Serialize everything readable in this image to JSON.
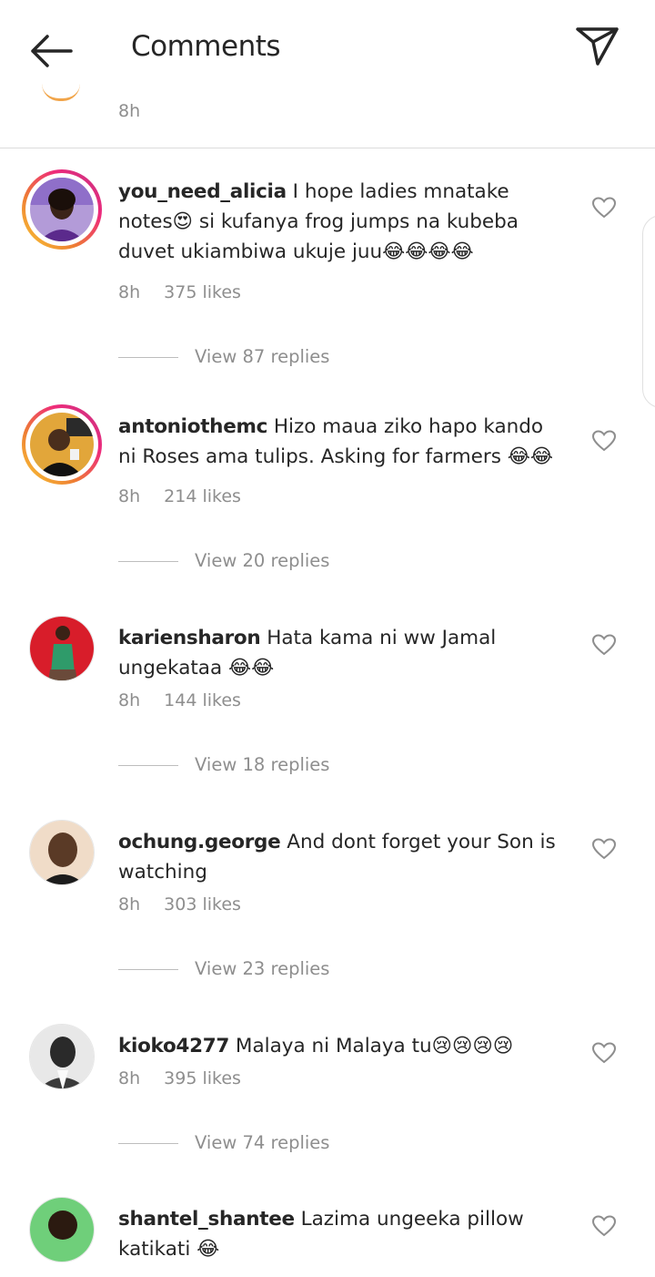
{
  "header": {
    "title": "Comments"
  },
  "previous": {
    "time": "8h"
  },
  "comments": [
    {
      "username": "you_need_alicia",
      "text": "I hope ladies mnatake notes😍 si kufanya frog jumps na kubeba duvet ukiambiwa ukuje juu😂😂😂😂",
      "time": "8h",
      "likes": "375 likes",
      "replies": "View 87 replies"
    },
    {
      "username": "antoniothemc",
      "text": "Hizo maua ziko hapo kando ni Roses ama tulips. Asking for farmers 😂😂",
      "time": "8h",
      "likes": "214 likes",
      "replies": "View 20 replies"
    },
    {
      "username": "kariensharon",
      "text": "Hata kama ni ww Jamal ungekataa 😂😂",
      "time": "8h",
      "likes": "144 likes",
      "replies": "View 18 replies"
    },
    {
      "username": "ochung.george",
      "text": "And dont forget your Son is watching",
      "time": "8h",
      "likes": "303 likes",
      "replies": "View 23 replies"
    },
    {
      "username": "kioko4277",
      "text": "Malaya ni Malaya tu😢😢😢😢",
      "time": "8h",
      "likes": "395 likes",
      "replies": "View 74 replies"
    },
    {
      "username": "shantel_shantee",
      "text": "Lazima ungeeka pillow katikati 😂"
    }
  ],
  "colors": {
    "accent_ring_start": "#f9ce34",
    "accent_ring_end": "#c13584",
    "muted_text": "#8e8e8e",
    "primary_text": "#262626"
  }
}
